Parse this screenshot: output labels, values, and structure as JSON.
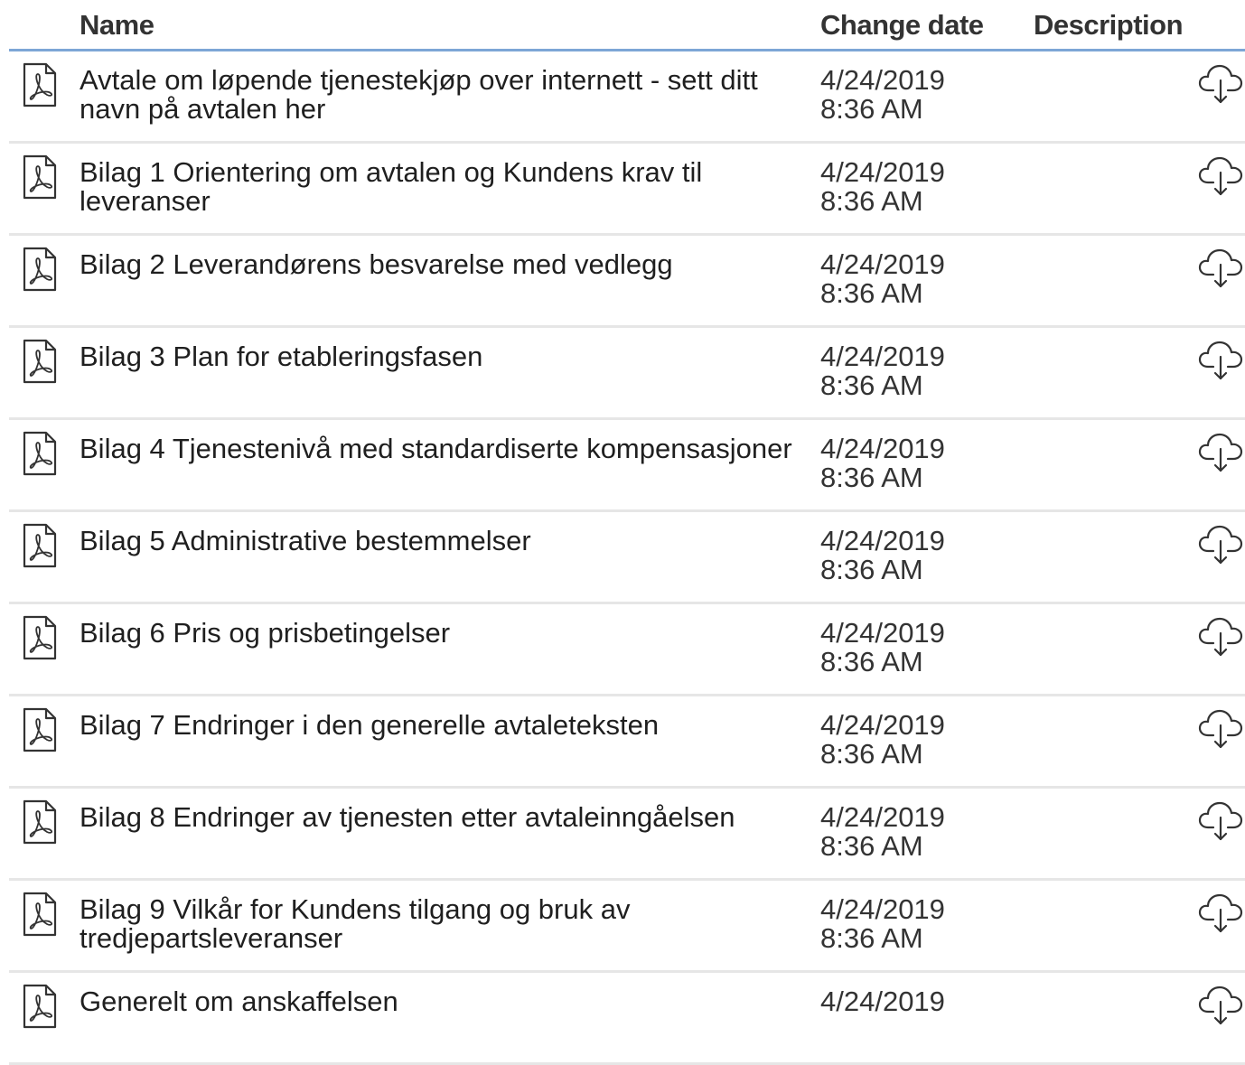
{
  "header": {
    "name": "Name",
    "change_date": "Change date",
    "description": "Description"
  },
  "icons": {
    "file": "pdf-file-icon",
    "download": "cloud-download-icon"
  },
  "rows": [
    {
      "name": "Avtale om løpende tjenestekjøp over internett - sett ditt navn på avtalen her",
      "date": "4/24/2019",
      "time": "8:36 AM",
      "description": ""
    },
    {
      "name": "Bilag 1 Orientering om avtalen og Kundens krav til leveranser",
      "date": "4/24/2019",
      "time": "8:36 AM",
      "description": ""
    },
    {
      "name": "Bilag 2 Leverandørens besvarelse med vedlegg",
      "date": "4/24/2019",
      "time": "8:36 AM",
      "description": ""
    },
    {
      "name": "Bilag 3 Plan for etableringsfasen",
      "date": "4/24/2019",
      "time": "8:36 AM",
      "description": ""
    },
    {
      "name": "Bilag 4 Tjenestenivå med standardiserte kompensasjoner",
      "date": "4/24/2019",
      "time": "8:36 AM",
      "description": ""
    },
    {
      "name": "Bilag 5 Administrative bestemmelser",
      "date": "4/24/2019",
      "time": "8:36 AM",
      "description": ""
    },
    {
      "name": "Bilag 6 Pris og prisbetingelser",
      "date": "4/24/2019",
      "time": "8:36 AM",
      "description": ""
    },
    {
      "name": "Bilag 7 Endringer i den generelle avtaleteksten",
      "date": "4/24/2019",
      "time": "8:36 AM",
      "description": ""
    },
    {
      "name": "Bilag 8 Endringer av tjenesten etter avtaleinngåelsen",
      "date": "4/24/2019",
      "time": "8:36 AM",
      "description": ""
    },
    {
      "name": "Bilag 9 Vilkår for Kundens tilgang og bruk av tredjepartsleveranser",
      "date": "4/24/2019",
      "time": "8:36 AM",
      "description": ""
    },
    {
      "name": "Generelt om anskaffelsen",
      "date": "4/24/2019",
      "time": "",
      "description": ""
    }
  ]
}
